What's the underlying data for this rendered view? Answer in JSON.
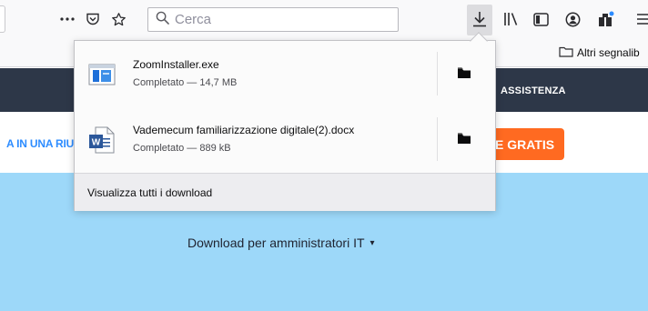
{
  "toolbar": {
    "overflow_icon": "ellipsis-icon",
    "pocket_icon": "pocket-icon",
    "star_icon": "bookmark-star-icon",
    "search_placeholder": "Cerca",
    "download_icon": "download-arrow-icon",
    "library_icon": "library-icon",
    "sidebar_icon": "sidebar-icon",
    "account_icon": "account-icon",
    "extension_icon": "extension-icon",
    "menu_icon": "hamburger-menu-icon"
  },
  "bookmarks": {
    "other_label": "Altri segnalib"
  },
  "page": {
    "nav_link": "ASSISTENZA",
    "promo_text": "A IN UNA RIU",
    "cta_label": "E GRATIS",
    "hero_link": "Download per amministratori IT",
    "hero_caret": "▾",
    "colors": {
      "nav_bg": "#2d3748",
      "cta_bg": "#ff6a21",
      "hero_bg": "#9dd8f9",
      "promo_text": "#2d8cff"
    }
  },
  "downloads": {
    "items": [
      {
        "name": "ZoomInstaller.exe",
        "status": "Completato — 14,7 MB",
        "icon": "exe-file-icon"
      },
      {
        "name": "Vademecum familiarizzazione digitale(2).docx",
        "status": "Completato — 889 kB",
        "icon": "word-document-icon"
      }
    ],
    "show_all_label": "Visualizza tutti i download"
  }
}
